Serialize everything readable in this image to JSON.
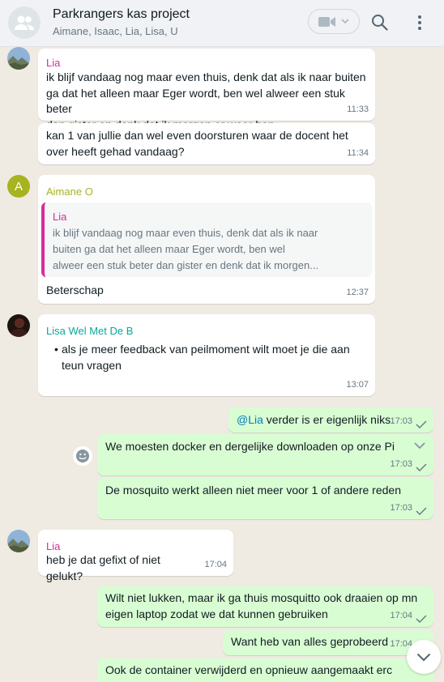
{
  "header": {
    "title": "Parkrangers kas project",
    "members": "Aimane, Isaac, Lia, Lisa, U"
  },
  "colors": {
    "lia": "#d42e9c",
    "aimane": "#a7b31f",
    "lisa": "#06a89c",
    "incoming": "#ffffff",
    "outgoing": "#d9fdd3",
    "mention": "#027eb5"
  },
  "messages": [
    {
      "sender": "Lia",
      "text": "ik blijf vandaag nog maar even thuis, denk dat als ik naar buiten\nga dat het alleen maar Eger wordt, ben wel alweer een stuk beter\ndan gister en denk dat ik morgen er weer ben",
      "time": "11:33"
    },
    {
      "text": "kan 1 van jullie dan wel even doorsturen waar de docent het\nover heeft gehad vandaag?",
      "time": "11:34"
    },
    {
      "sender": "Aimane O",
      "avatar_letter": "A",
      "quote": {
        "sender": "Lia",
        "text": "ik blijf vandaag nog maar even thuis, denk dat als ik naar\nbuiten ga dat het alleen maar Eger wordt, ben wel\nalweer een stuk beter dan gister en denk dat ik morgen..."
      },
      "text": "Beterschap",
      "time": "12:37"
    },
    {
      "sender": "Lisa Wel Met De B",
      "bullet": "•",
      "text": "als je meer feedback van peilmoment wilt moet je die aan\nteun vragen",
      "time": "13:07"
    },
    {
      "mention": "@Lia",
      "text": " verder is er eigenlijk niks",
      "time": "17:03"
    },
    {
      "text": "We moesten docker en dergelijke downloaden op onze Pi",
      "time": "17:03"
    },
    {
      "text": "De mosquito werkt alleen niet meer voor 1 of andere reden",
      "time": "17:03"
    },
    {
      "sender": "Lia",
      "text": "heb je dat gefixt of niet gelukt?",
      "time": "17:04"
    },
    {
      "text": "Wilt niet lukken, maar ik ga thuis mosquitto ook draaien op mn\neigen laptop zodat we dat kunnen gebruiken",
      "time": "17:04"
    },
    {
      "text": "Want heb van alles geprobeerd",
      "time": "17:04"
    },
    {
      "text": "Ook de container verwijderd en opnieuw aangemaakt erc"
    }
  ]
}
